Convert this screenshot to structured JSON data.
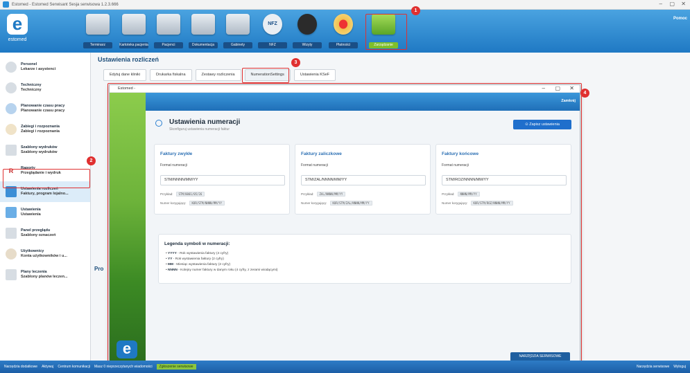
{
  "window": {
    "title": "Estomed - Estomed Serwisant Sesja serwisowa 1.2.3.666"
  },
  "logo": {
    "letter": "e",
    "word": "estomed"
  },
  "user": {
    "name": "Pomoc"
  },
  "toolbar": {
    "items": [
      {
        "label": "Terminarz"
      },
      {
        "label": "Kartoteka pacjenta"
      },
      {
        "label": "Pacjenci"
      },
      {
        "label": "Dokumentacja"
      },
      {
        "label": "Gabinety"
      },
      {
        "label": "NFZ",
        "mark": "NFZ"
      },
      {
        "label": "Wizyty"
      },
      {
        "label": "Płatności"
      },
      {
        "label": "Zarządzanie"
      }
    ]
  },
  "badges": {
    "b1": "1",
    "b2": "2",
    "b3": "3",
    "b4": "4"
  },
  "sidebar": {
    "items": [
      {
        "title": "Personel",
        "sub": "Lekarze i asystenci"
      },
      {
        "title": "Techniczny",
        "sub": "Techniczny"
      },
      {
        "title": "Planowanie czasu pracy",
        "sub": "Planowanie czasu pracy"
      },
      {
        "title": "Zabiegi i rozpoznania",
        "sub": "Zabiegi i rozpoznania"
      },
      {
        "title": "Szablony wydruków",
        "sub": "Szablony wydruków"
      },
      {
        "title": "Raporty",
        "sub": "Przeglądanie i wydruk"
      },
      {
        "title": "Ustawienia rozliczeń",
        "sub": "Faktury, program lojalno..."
      },
      {
        "title": "Ustawienia",
        "sub": "Ustawienia"
      },
      {
        "title": "Panel przeglądu",
        "sub": "Szablony oznaczeń"
      },
      {
        "title": "Użytkownicy",
        "sub": "Konta użytkowników i u..."
      },
      {
        "title": "Plany leczenia",
        "sub": "Szablony planów leczen..."
      }
    ]
  },
  "main": {
    "title": "Ustawienia rozliczeń",
    "tabs": [
      "Edytuj dane kliniki",
      "Drukarka fiskalna",
      "Zestawy rozliczenia",
      "NumerationSettings",
      "Ustawienia KSeF"
    ],
    "partial_label": "Pro"
  },
  "dialog": {
    "title": "Estomed -",
    "close_label": "Zamknij",
    "heading": "Ustawienia numeracji",
    "subheading": "Skonfiguruj ustawienia numeracji faktur",
    "save_label": "Zapisz ustawienia",
    "format_label": "Format numeracji",
    "example_label": "Przykład:",
    "correction_label": "Numer korygujący:",
    "cards": [
      {
        "title": "Faktury zwykłe",
        "value": "STM/NNNN/MM/YY",
        "example": "STM/0001/05/26",
        "correction": "KOR/STM/NNNN/MM/YY"
      },
      {
        "title": "Faktury zaliczkowe",
        "value": "STM/ZAL/NNNN/MM/YY",
        "example": "ZAL/NNNN/MM/YY",
        "correction": "KOR/STM/ZAL/NNNN/MM/YY"
      },
      {
        "title": "Faktury końcowe",
        "value": "STM/ROZ/NNNN/MM/YY",
        "example": "NNNN/MM/YY",
        "correction": "KOR/STM/ROZ/NNNN/MM/YY"
      }
    ],
    "legend": {
      "title": "Legenda symboli w numeracji:",
      "items": [
        {
          "key": "YYYY",
          "desc": " - Rok wystawienia faktury (4 cyfry)"
        },
        {
          "key": "YY",
          "desc": " - Rok wystawienia faktury (2 cyfry)"
        },
        {
          "key": "MM",
          "desc": " - Miesiąc wystawienia faktury (2 cyfry)"
        },
        {
          "key": "NNNN",
          "desc": " - Kolejny numer faktury w danym roku (4 cyfry, z zerami wiodącymi)"
        }
      ]
    },
    "tools_label": "NARZĘDZIA SERWISOWE"
  },
  "statusbar": {
    "left": [
      "Narzędzia dodatkowe",
      "Aktywuj",
      "Centrum komunikacji",
      "Masz 0 nieprzeczytanych wiadomości",
      "Zgłoszenie serwisowe"
    ],
    "right": [
      "Narzędzia serwisowe",
      "Wyloguj"
    ]
  },
  "colors": {
    "accent": "#1f79c4",
    "highlight": "#e03030",
    "active_green": "#7fbf2a"
  }
}
